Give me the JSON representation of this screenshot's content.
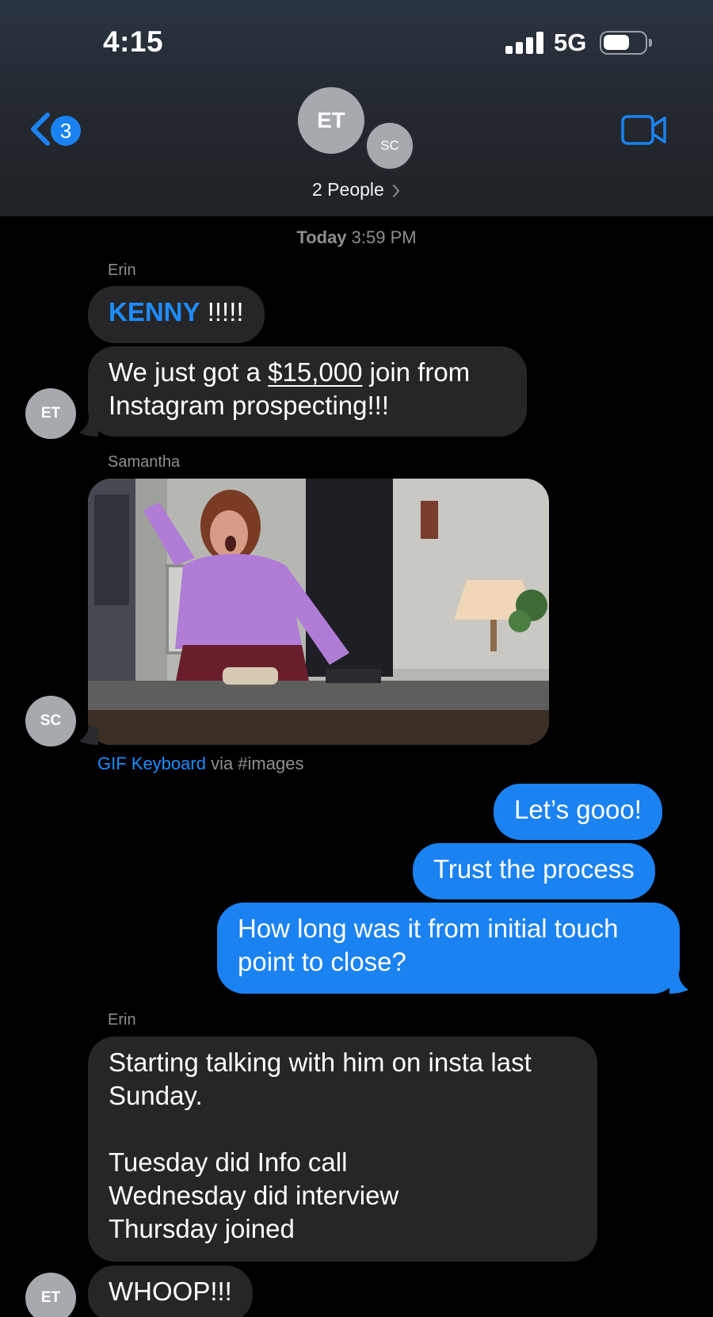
{
  "status_bar": {
    "time": "4:15",
    "network": "5G"
  },
  "header": {
    "back_count": "3",
    "avatars": [
      "ET",
      "SC"
    ],
    "people_label": "2 People",
    "icons": {
      "back": "chevron-left-icon",
      "video": "video-camera-icon",
      "signal": "signal-bars-icon",
      "battery": "battery-icon"
    }
  },
  "conversation": {
    "timestamp_day": "Today",
    "timestamp_time": "3:59 PM",
    "messages": [
      {
        "sender": "Erin",
        "direction": "incoming",
        "name_part": "KENNY",
        "rest": " !!!!!"
      },
      {
        "direction": "incoming",
        "text_before": "We just got a ",
        "amount": "$15,000",
        "text_after": " join from",
        "line2": "Instagram prospecting!!!",
        "avatar": "ET"
      },
      {
        "sender": "Samantha",
        "direction": "incoming",
        "type": "gif",
        "avatar": "SC",
        "caption_brand": "GIF Keyboard",
        "caption_rest": " via #images"
      },
      {
        "direction": "outgoing",
        "text": "Let’s gooo!"
      },
      {
        "direction": "outgoing",
        "text": "Trust the process"
      },
      {
        "direction": "outgoing",
        "line1": "How long was it from initial touch",
        "line2": "point to close?"
      },
      {
        "sender": "Erin",
        "direction": "incoming",
        "lines": [
          "Starting talking with him on insta last",
          "Sunday.",
          "",
          "Tuesday did Info call",
          "Wednesday did interview",
          "Thursday joined"
        ]
      },
      {
        "direction": "incoming",
        "text": "WHOOP!!!",
        "avatar": "ET"
      }
    ]
  },
  "colors": {
    "blue": "#1b82f2",
    "incoming_bubble": "#262628",
    "avatar_gray": "#a6a9ae",
    "meta_text": "#8e8e93"
  }
}
